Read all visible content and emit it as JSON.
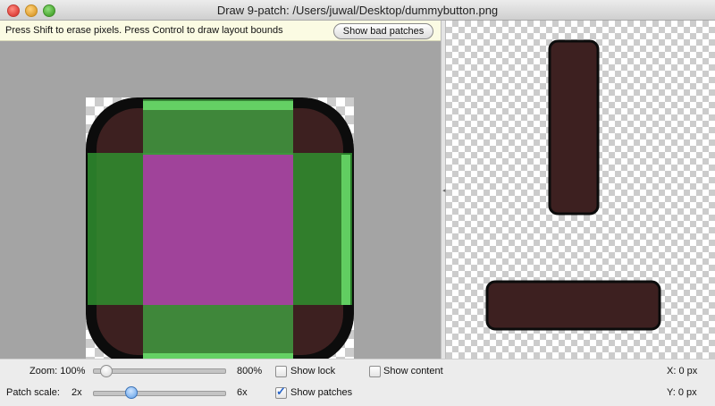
{
  "window": {
    "title": "Draw 9-patch: /Users/juwal/Desktop/dummybutton.png"
  },
  "hint_bar": {
    "text": "Press Shift to erase pixels. Press Control to draw layout bounds",
    "bad_patches_button": "Show bad patches"
  },
  "colors": {
    "button_fill": "#3d2020",
    "patch_green": "#4caf50",
    "content_purple": "#a0439a",
    "editor_bg": "#a4a4a4"
  },
  "controls": {
    "zoom_label": "Zoom: 100%",
    "zoom_max": "800%",
    "zoom_level": 0.06,
    "scale_label": "Patch scale:",
    "scale_min": "2x",
    "scale_max": "6x",
    "scale_level": 0.27,
    "show_lock": "Show lock",
    "show_lock_checked": false,
    "show_content": "Show content",
    "show_content_checked": false,
    "show_patches": "Show patches",
    "show_patches_checked": true,
    "x_readout": "X: 0 px",
    "y_readout": "Y: 0 px"
  }
}
